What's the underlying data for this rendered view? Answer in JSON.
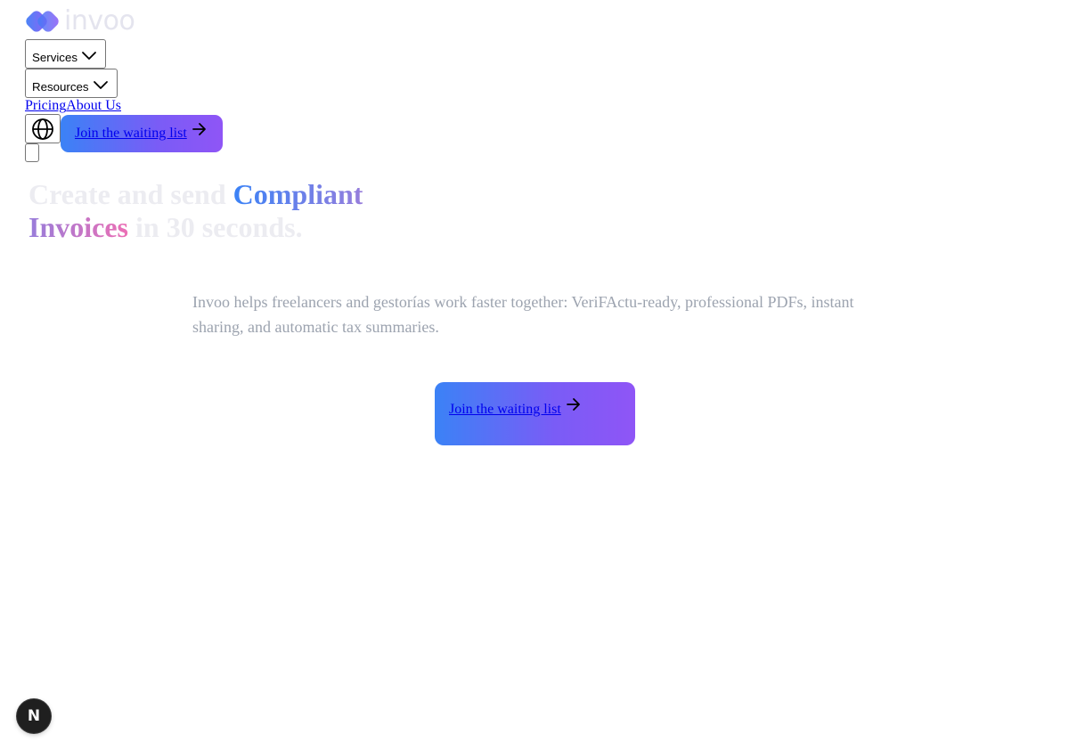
{
  "brand": {
    "logo_text": "invoo",
    "logo_icon": "invoo-logo-icon"
  },
  "nav": {
    "services_label": "Services",
    "resources_label": "Resources",
    "pricing_label": "Pricing",
    "about_label": "About Us",
    "language_icon": "globe-icon",
    "cta_label": "Join the waiting list"
  },
  "hero": {
    "headline_part1": "Create and send ",
    "headline_highlight": "Compliant Invoices",
    "headline_part2": " in 30 seconds.",
    "subtitle": "Invoo helps freelancers and gestorías work faster together: VeriFActu-ready, professional PDFs, instant sharing, and automatic tax summaries.",
    "cta_label": "Join the waiting list"
  },
  "dev_badge": {
    "label": "N"
  },
  "colors": {
    "gradient_start": "#3b82f6",
    "gradient_end": "#8f55f6",
    "highlight_pink": "#ec6fb5",
    "muted_text": "#ececf1",
    "subtitle_text": "#9ca3af",
    "link": "#0000ee"
  }
}
